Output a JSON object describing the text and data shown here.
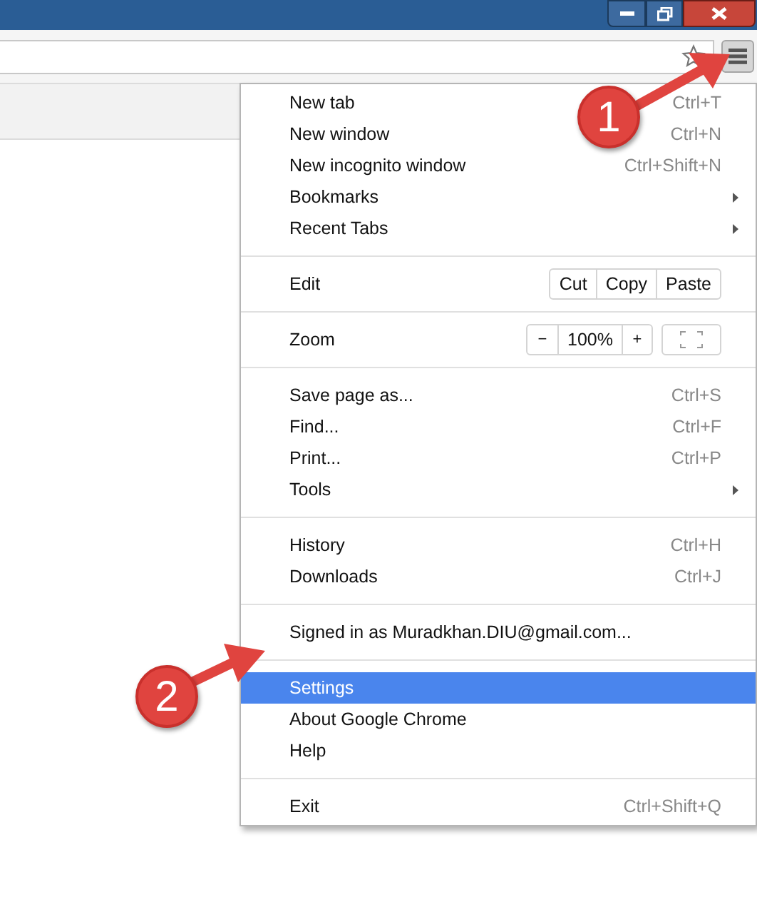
{
  "menu": [
    {
      "kind": "item",
      "label": "New tab",
      "shortcut": "Ctrl+T",
      "selected": false
    },
    {
      "kind": "item",
      "label": "New window",
      "shortcut": "Ctrl+N",
      "selected": false
    },
    {
      "kind": "item",
      "label": "New incognito window",
      "shortcut": "Ctrl+Shift+N",
      "selected": false
    },
    {
      "kind": "item",
      "label": "Bookmarks",
      "submenu": true,
      "selected": false
    },
    {
      "kind": "item",
      "label": "Recent Tabs",
      "submenu": true,
      "selected": false
    },
    {
      "kind": "separator"
    },
    {
      "kind": "edit",
      "label": "Edit",
      "buttons": [
        "Cut",
        "Copy",
        "Paste"
      ]
    },
    {
      "kind": "separator"
    },
    {
      "kind": "zoom",
      "label": "Zoom",
      "minus": "−",
      "value": "100%",
      "plus": "+"
    },
    {
      "kind": "separator"
    },
    {
      "kind": "item",
      "label": "Save page as...",
      "shortcut": "Ctrl+S",
      "selected": false
    },
    {
      "kind": "item",
      "label": "Find...",
      "shortcut": "Ctrl+F",
      "selected": false
    },
    {
      "kind": "item",
      "label": "Print...",
      "shortcut": "Ctrl+P",
      "selected": false
    },
    {
      "kind": "item",
      "label": "Tools",
      "submenu": true,
      "selected": false
    },
    {
      "kind": "separator"
    },
    {
      "kind": "item",
      "label": "History",
      "shortcut": "Ctrl+H",
      "selected": false
    },
    {
      "kind": "item",
      "label": "Downloads",
      "shortcut": "Ctrl+J",
      "selected": false
    },
    {
      "kind": "separator"
    },
    {
      "kind": "item",
      "label": "Signed in as Muradkhan.DIU@gmail.com...",
      "selected": false
    },
    {
      "kind": "separator"
    },
    {
      "kind": "item",
      "label": "Settings",
      "selected": true
    },
    {
      "kind": "item",
      "label": "About Google Chrome",
      "selected": false
    },
    {
      "kind": "item",
      "label": "Help",
      "selected": false
    },
    {
      "kind": "separator"
    },
    {
      "kind": "item",
      "label": "Exit",
      "shortcut": "Ctrl+Shift+Q",
      "selected": false
    }
  ],
  "callouts": [
    "1",
    "2"
  ]
}
